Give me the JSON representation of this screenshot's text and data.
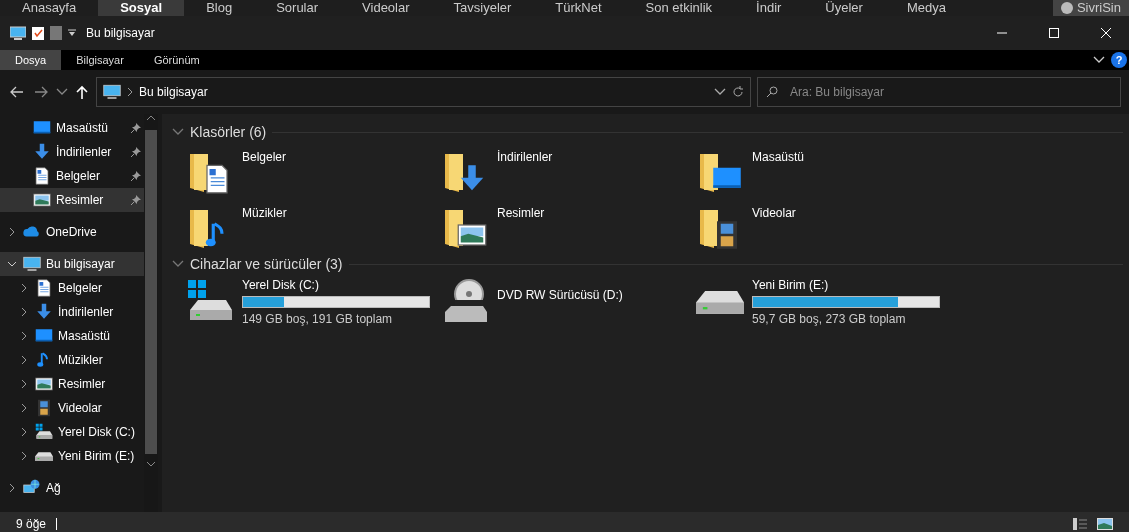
{
  "browser_tabs": [
    {
      "label": "Anasayfa",
      "selected": false
    },
    {
      "label": "Sosyal",
      "selected": true
    },
    {
      "label": "Blog",
      "selected": false
    },
    {
      "label": "Sorular",
      "selected": false
    },
    {
      "label": "Videolar",
      "selected": false
    },
    {
      "label": "Tavsiyeler",
      "selected": false
    },
    {
      "label": "TürkNet",
      "selected": false
    },
    {
      "label": "Son etkinlik",
      "selected": false
    },
    {
      "label": "İndir",
      "selected": false
    },
    {
      "label": "Üyeler",
      "selected": false
    },
    {
      "label": "Medya",
      "selected": false
    }
  ],
  "browser_user": "SivriSin",
  "window": {
    "title": "Bu bilgisayar"
  },
  "ribbon_tabs": [
    {
      "label": "Dosya",
      "selected": true
    },
    {
      "label": "Bilgisayar",
      "selected": false
    },
    {
      "label": "Görünüm",
      "selected": false
    }
  ],
  "help": "?",
  "address": {
    "path": "Bu bilgisayar"
  },
  "search": {
    "placeholder": "Ara: Bu bilgisayar"
  },
  "quick_access": [
    {
      "label": "Masaüstü",
      "kind": "desktop",
      "pinned": true,
      "selected": false
    },
    {
      "label": "İndirilenler",
      "kind": "downloads",
      "pinned": true,
      "selected": false
    },
    {
      "label": "Belgeler",
      "kind": "documents",
      "pinned": true,
      "selected": false
    },
    {
      "label": "Resimler",
      "kind": "pictures",
      "pinned": true,
      "selected": true
    }
  ],
  "tree": [
    {
      "label": "OneDrive",
      "kind": "cloud",
      "expanded": false,
      "selected": false
    },
    {
      "label": "Bu bilgisayar",
      "kind": "computer",
      "expanded": true,
      "selected": true,
      "children": [
        {
          "label": "Belgeler",
          "kind": "documents",
          "expanded": false,
          "selected": false
        },
        {
          "label": "İndirilenler",
          "kind": "downloads",
          "expanded": false,
          "selected": false
        },
        {
          "label": "Masaüstü",
          "kind": "desktop",
          "expanded": false,
          "selected": false
        },
        {
          "label": "Müzikler",
          "kind": "music",
          "expanded": false,
          "selected": false
        },
        {
          "label": "Resimler",
          "kind": "pictures",
          "expanded": false,
          "selected": false
        },
        {
          "label": "Videolar",
          "kind": "videos",
          "expanded": false,
          "selected": false
        },
        {
          "label": "Yerel Disk (C:)",
          "kind": "system-drive",
          "expanded": false,
          "selected": false
        },
        {
          "label": "Yeni Birim (E:)",
          "kind": "drive",
          "expanded": false,
          "selected": false
        }
      ]
    },
    {
      "label": "Ağ",
      "kind": "network",
      "expanded": false,
      "selected": false
    }
  ],
  "sections": [
    {
      "title": "Klasörler (6)",
      "expanded": true,
      "items": [
        {
          "kind": "documents",
          "label": "Belgeler"
        },
        {
          "kind": "downloads",
          "label": "İndirilenler"
        },
        {
          "kind": "desktop",
          "label": "Masaüstü"
        },
        {
          "kind": "music",
          "label": "Müzikler"
        },
        {
          "kind": "pictures",
          "label": "Resimler"
        },
        {
          "kind": "videos",
          "label": "Videolar"
        }
      ]
    },
    {
      "title": "Cihazlar ve sürücüler (3)",
      "expanded": true,
      "items": [
        {
          "kind": "system-drive",
          "label": "Yerel Disk (C:)",
          "level": 0.22,
          "detail": "149 GB boş, 191 GB toplam"
        },
        {
          "kind": "dvd",
          "label": "DVD RW Sürücüsü (D:)"
        },
        {
          "kind": "drive",
          "label": "Yeni Birim (E:)",
          "level": 0.78,
          "detail": "59,7 GB boş, 273 GB toplam"
        }
      ]
    }
  ],
  "status": "9 öğe"
}
